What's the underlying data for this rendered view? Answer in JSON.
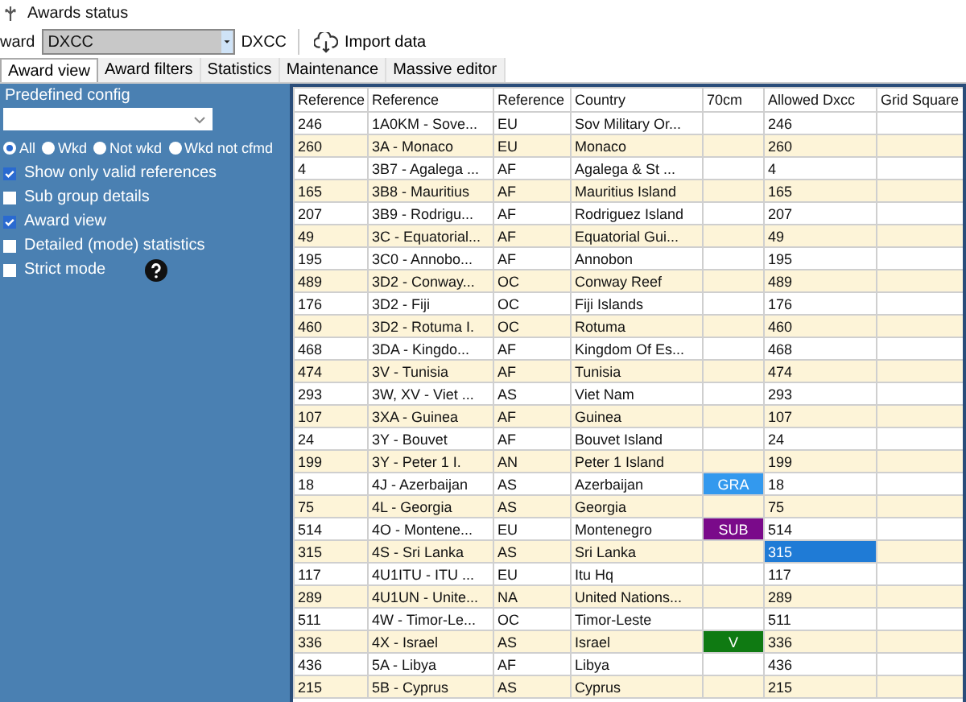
{
  "window": {
    "title": "Awards status"
  },
  "toolbar": {
    "award_label": "ward",
    "award_combo": {
      "value": "DXCC"
    },
    "award_name": "DXCC",
    "import_button": "Import data"
  },
  "tabs": [
    {
      "label": "Award view",
      "selected": true
    },
    {
      "label": "Award filters",
      "selected": false
    },
    {
      "label": "Statistics",
      "selected": false
    },
    {
      "label": "Maintenance",
      "selected": false
    },
    {
      "label": "Massive editor",
      "selected": false
    }
  ],
  "sidebar": {
    "predefined_label": "Predefined config",
    "filter_radios": [
      {
        "label": "All",
        "selected": true
      },
      {
        "label": "Wkd",
        "selected": false
      },
      {
        "label": "Not wkd",
        "selected": false
      },
      {
        "label": "Wkd not cfmd",
        "selected": false
      }
    ],
    "options": [
      {
        "label": "Show only valid references",
        "checked": true,
        "help": false
      },
      {
        "label": "Sub group details",
        "checked": false,
        "help": false
      },
      {
        "label": "Award view",
        "checked": true,
        "help": false
      },
      {
        "label": "Detailed (mode) statistics",
        "checked": false,
        "help": false
      },
      {
        "label": "Strict mode",
        "checked": false,
        "help": true
      }
    ]
  },
  "table": {
    "columns": [
      "Reference",
      "Reference",
      "Reference",
      "Country",
      "70cm",
      "Allowed Dxcc",
      "Grid Square"
    ],
    "rows": [
      {
        "cells": [
          "246",
          "1A0KM - Sove...",
          "EU",
          "Sov Military Or...",
          "",
          "246",
          ""
        ],
        "badge": null,
        "selected": false
      },
      {
        "cells": [
          "260",
          "3A - Monaco",
          "EU",
          "Monaco",
          "",
          "260",
          ""
        ],
        "badge": null,
        "selected": false
      },
      {
        "cells": [
          "4",
          "3B7 - Agalega ...",
          "AF",
          "Agalega & St ...",
          "",
          "4",
          ""
        ],
        "badge": null,
        "selected": false
      },
      {
        "cells": [
          "165",
          "3B8 - Mauritius",
          "AF",
          "Mauritius Island",
          "",
          "165",
          ""
        ],
        "badge": null,
        "selected": false
      },
      {
        "cells": [
          "207",
          "3B9 - Rodrigu...",
          "AF",
          "Rodriguez Island",
          "",
          "207",
          ""
        ],
        "badge": null,
        "selected": false
      },
      {
        "cells": [
          "49",
          "3C - Equatorial...",
          "AF",
          "Equatorial Gui...",
          "",
          "49",
          ""
        ],
        "badge": null,
        "selected": false
      },
      {
        "cells": [
          "195",
          "3C0 - Annobo...",
          "AF",
          "Annobon",
          "",
          "195",
          ""
        ],
        "badge": null,
        "selected": false
      },
      {
        "cells": [
          "489",
          "3D2 - Conway...",
          "OC",
          "Conway Reef",
          "",
          "489",
          ""
        ],
        "badge": null,
        "selected": false
      },
      {
        "cells": [
          "176",
          "3D2 - Fiji",
          "OC",
          "Fiji Islands",
          "",
          "176",
          ""
        ],
        "badge": null,
        "selected": false
      },
      {
        "cells": [
          "460",
          "3D2 - Rotuma I.",
          "OC",
          "Rotuma",
          "",
          "460",
          ""
        ],
        "badge": null,
        "selected": false
      },
      {
        "cells": [
          "468",
          "3DA - Kingdo...",
          "AF",
          "Kingdom Of Es...",
          "",
          "468",
          ""
        ],
        "badge": null,
        "selected": false
      },
      {
        "cells": [
          "474",
          "3V - Tunisia",
          "AF",
          "Tunisia",
          "",
          "474",
          ""
        ],
        "badge": null,
        "selected": false
      },
      {
        "cells": [
          "293",
          "3W, XV - Viet ...",
          "AS",
          "Viet Nam",
          "",
          "293",
          ""
        ],
        "badge": null,
        "selected": false
      },
      {
        "cells": [
          "107",
          "3XA - Guinea",
          "AF",
          "Guinea",
          "",
          "107",
          ""
        ],
        "badge": null,
        "selected": false
      },
      {
        "cells": [
          "24",
          "3Y - Bouvet",
          "AF",
          "Bouvet Island",
          "",
          "24",
          ""
        ],
        "badge": null,
        "selected": false
      },
      {
        "cells": [
          "199",
          "3Y - Peter 1 I.",
          "AN",
          "Peter 1 Island",
          "",
          "199",
          ""
        ],
        "badge": null,
        "selected": false
      },
      {
        "cells": [
          "18",
          "4J - Azerbaijan",
          "AS",
          "Azerbaijan",
          "GRA",
          "18",
          ""
        ],
        "badge": {
          "color": "#3399ee"
        },
        "selected": false
      },
      {
        "cells": [
          "75",
          "4L - Georgia",
          "AS",
          "Georgia",
          "",
          "75",
          ""
        ],
        "badge": null,
        "selected": false
      },
      {
        "cells": [
          "514",
          "4O - Montene...",
          "EU",
          "Montenegro",
          "SUB",
          "514",
          ""
        ],
        "badge": {
          "color": "#7a0a8a"
        },
        "selected": false
      },
      {
        "cells": [
          "315",
          "4S - Sri Lanka",
          "AS",
          "Sri Lanka",
          "",
          "315",
          ""
        ],
        "badge": null,
        "selected": true
      },
      {
        "cells": [
          "117",
          "4U1ITU - ITU ...",
          "EU",
          "Itu Hq",
          "",
          "117",
          ""
        ],
        "badge": null,
        "selected": false
      },
      {
        "cells": [
          "289",
          "4U1UN - Unite...",
          "NA",
          "United Nations...",
          "",
          "289",
          ""
        ],
        "badge": null,
        "selected": false
      },
      {
        "cells": [
          "511",
          "4W - Timor-Le...",
          "OC",
          "Timor-Leste",
          "",
          "511",
          ""
        ],
        "badge": null,
        "selected": false
      },
      {
        "cells": [
          "336",
          "4X - Israel",
          "AS",
          "Israel",
          "V",
          "336",
          ""
        ],
        "badge": {
          "color": "#0f7a12"
        },
        "selected": false
      },
      {
        "cells": [
          "436",
          "5A - Libya",
          "AF",
          "Libya",
          "",
          "436",
          ""
        ],
        "badge": null,
        "selected": false
      },
      {
        "cells": [
          "215",
          "5B - Cyprus",
          "AS",
          "Cyprus",
          "",
          "215",
          ""
        ],
        "badge": null,
        "selected": false
      }
    ]
  }
}
